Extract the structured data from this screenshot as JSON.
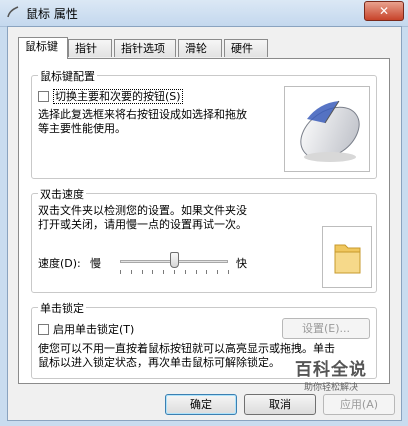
{
  "window": {
    "title": "鼠标 属性",
    "close_label": "✕"
  },
  "tabs": [
    {
      "label": "鼠标键",
      "active": true
    },
    {
      "label": "指针"
    },
    {
      "label": "指针选项"
    },
    {
      "label": "滑轮"
    },
    {
      "label": "硬件"
    }
  ],
  "button_config": {
    "group_title": "鼠标键配置",
    "switch_checkbox_label": "切换主要和次要的按钮(S)",
    "switch_checked": false,
    "description": [
      "选择此复选框来将右按钮设成如选择和拖放",
      "等主要性能使用。"
    ]
  },
  "double_click": {
    "group_title": "双击速度",
    "description": [
      "双击文件夹以检测您的设置。如果文件夹没",
      "打开或关闭，请用慢一点的设置再试一次。"
    ],
    "speed_label": "速度(D):",
    "slow_label": "慢",
    "fast_label": "快",
    "speed_value": 0.5
  },
  "click_lock": {
    "group_title": "单击锁定",
    "checkbox_label": "启用单击锁定(T)",
    "checked": false,
    "settings_button": "设置(E)...",
    "description": [
      "使您可以不用一直按着鼠标按钮就可以高亮显示或拖拽。单击",
      "鼠标以进入锁定状态，再次单击鼠标可解除锁定。"
    ]
  },
  "footer": {
    "ok_label": "确定",
    "cancel_label": "取消",
    "apply_label": "应用(A)"
  },
  "watermark": {
    "title": "百科全说",
    "subtitle": "助你轻松解决"
  }
}
